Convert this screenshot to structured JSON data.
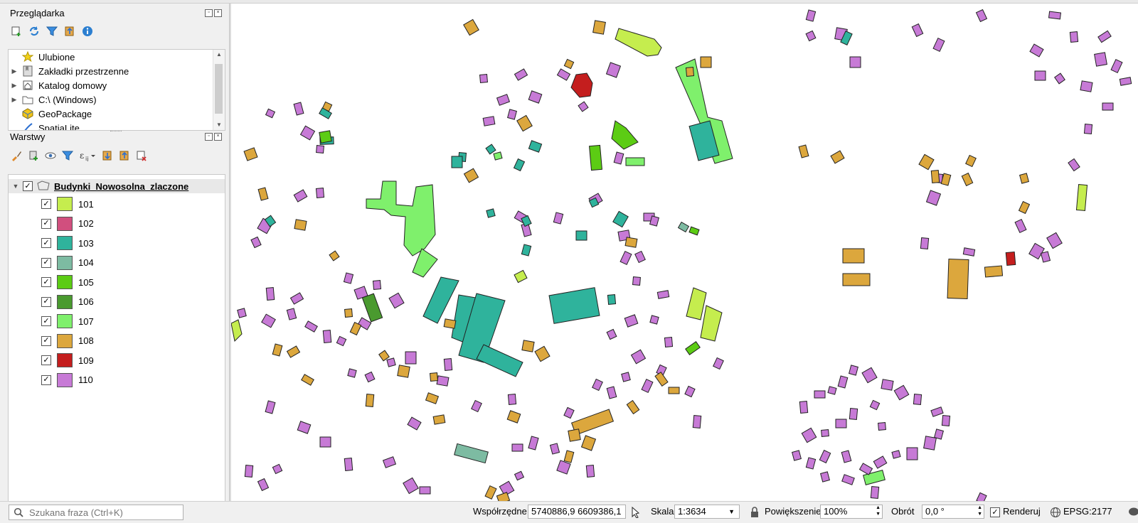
{
  "browser_panel": {
    "title": "Przeglądarka",
    "items": [
      {
        "label": "Ulubione",
        "icon": "star-icon",
        "expandable": false
      },
      {
        "label": "Zakładki przestrzenne",
        "icon": "bookmark-icon",
        "expandable": true
      },
      {
        "label": "Katalog domowy",
        "icon": "home-folder-icon",
        "expandable": true
      },
      {
        "label": "C:\\ (Windows)",
        "icon": "folder-icon",
        "expandable": true
      },
      {
        "label": "GeoPackage",
        "icon": "geopackage-icon",
        "expandable": false
      },
      {
        "label": "SpatiaLite",
        "icon": "spatialite-icon",
        "expandable": false
      }
    ]
  },
  "layers_panel": {
    "title": "Warstwy",
    "layer_name": "Budynki_Nowosolna_zlaczone",
    "classes": [
      {
        "label": "101",
        "color": "#c5ed4e"
      },
      {
        "label": "102",
        "color": "#d14f7e"
      },
      {
        "label": "103",
        "color": "#2fb39c"
      },
      {
        "label": "104",
        "color": "#7dbba2"
      },
      {
        "label": "105",
        "color": "#5ccc14"
      },
      {
        "label": "106",
        "color": "#4a9a2f"
      },
      {
        "label": "107",
        "color": "#7ff06c"
      },
      {
        "label": "108",
        "color": "#dca73d"
      },
      {
        "label": "109",
        "color": "#c41e1e"
      },
      {
        "label": "110",
        "color": "#c77ad6"
      }
    ]
  },
  "statusbar": {
    "search_placeholder": "Szukana fraza (Ctrl+K)",
    "coords_label": "Współrzędne",
    "coords_value": "5740886,9  6609386,1",
    "scale_label": "Skala",
    "scale_value": "1:3634",
    "zoom_label": "Powiększenie",
    "zoom_value": "100%",
    "rotation_label": "Obrót",
    "rotation_value": "0,0 °",
    "render_label": "Renderuj",
    "crs_label": "EPSG:2177"
  }
}
